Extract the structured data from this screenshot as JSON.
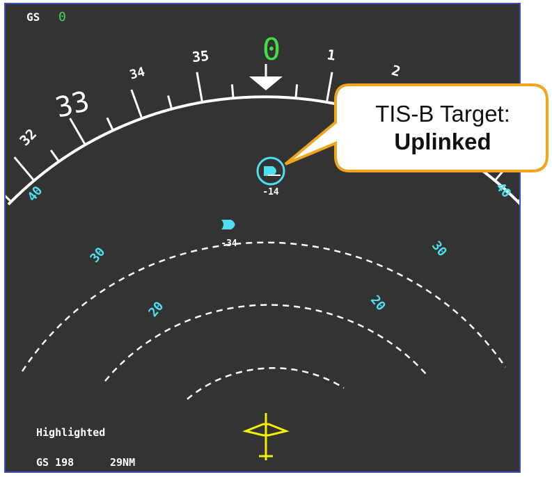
{
  "display": {
    "gs_top_label": "GS",
    "gs_top_value": "0",
    "selected_heading": "0",
    "heading_labels": [
      "32",
      "33",
      "34",
      "35",
      "1",
      "2"
    ],
    "range_labels": [
      "40",
      "40",
      "30",
      "30",
      "20",
      "20"
    ],
    "status_text": "Highlighted",
    "bottom_gs": "GS 198",
    "bottom_range": "29NM"
  },
  "targets": [
    {
      "altitude": "-14",
      "highlighted": true
    },
    {
      "altitude": "-34",
      "highlighted": false
    }
  ],
  "callout": {
    "line1": "TIS-B Target:",
    "line2": "Uplinked"
  },
  "colors": {
    "background": "#333333",
    "frame": "#3c4fb8",
    "white": "#ffffff",
    "cyan": "#4ee0f0",
    "green": "#44dd44",
    "yellow": "#f5f000",
    "callout_border": "#f0a520"
  }
}
